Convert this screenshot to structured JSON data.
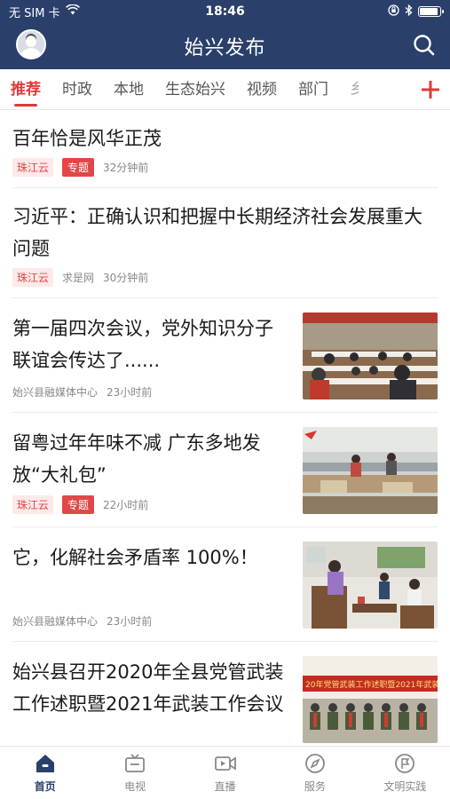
{
  "status_bar": {
    "carrier": "无 SIM 卡",
    "time": "18:46",
    "battery_level": 0.9
  },
  "header": {
    "title": "始兴发布"
  },
  "tabs": [
    {
      "label": "推荐",
      "active": true
    },
    {
      "label": "时政"
    },
    {
      "label": "本地"
    },
    {
      "label": "生态始兴"
    },
    {
      "label": "视频"
    },
    {
      "label": "部门"
    },
    {
      "label": "乡"
    }
  ],
  "feed": [
    {
      "title": "百年恰是风华正茂",
      "source": "珠江云",
      "topic": "专题",
      "time": "32分钟前"
    },
    {
      "title": "习近平：正确认识和把握中长期经济社会发展重大问题",
      "source": "珠江云",
      "publisher": "求是网",
      "time": "30分钟前"
    },
    {
      "title": "第一届四次会议，党外知识分子联谊会传达了......",
      "publisher": "始兴县融媒体中心",
      "time": "23小时前"
    },
    {
      "title": "留粤过年年味不减 广东多地发放“大礼包”",
      "source": "珠江云",
      "topic": "专题",
      "time": "22小时前"
    },
    {
      "title": "它，化解社会矛盾率 100%！",
      "publisher": "始兴县融媒体中心",
      "time": "23小时前"
    },
    {
      "title": "始兴县召开2020年全县党管武装工作述职暨2021年武装工作会议",
      "banner_text": "20年党管武装工作述职暨2021年武装"
    }
  ],
  "bottom_tabs": [
    {
      "label": "首页",
      "icon": "home-icon",
      "active": true
    },
    {
      "label": "电视",
      "icon": "tv-icon"
    },
    {
      "label": "直播",
      "icon": "live-icon"
    },
    {
      "label": "服务",
      "icon": "compass-icon"
    },
    {
      "label": "文明实践",
      "icon": "flag-icon"
    }
  ],
  "colors": {
    "header_bg": "#2b3f6b",
    "accent": "#e03a3a"
  }
}
